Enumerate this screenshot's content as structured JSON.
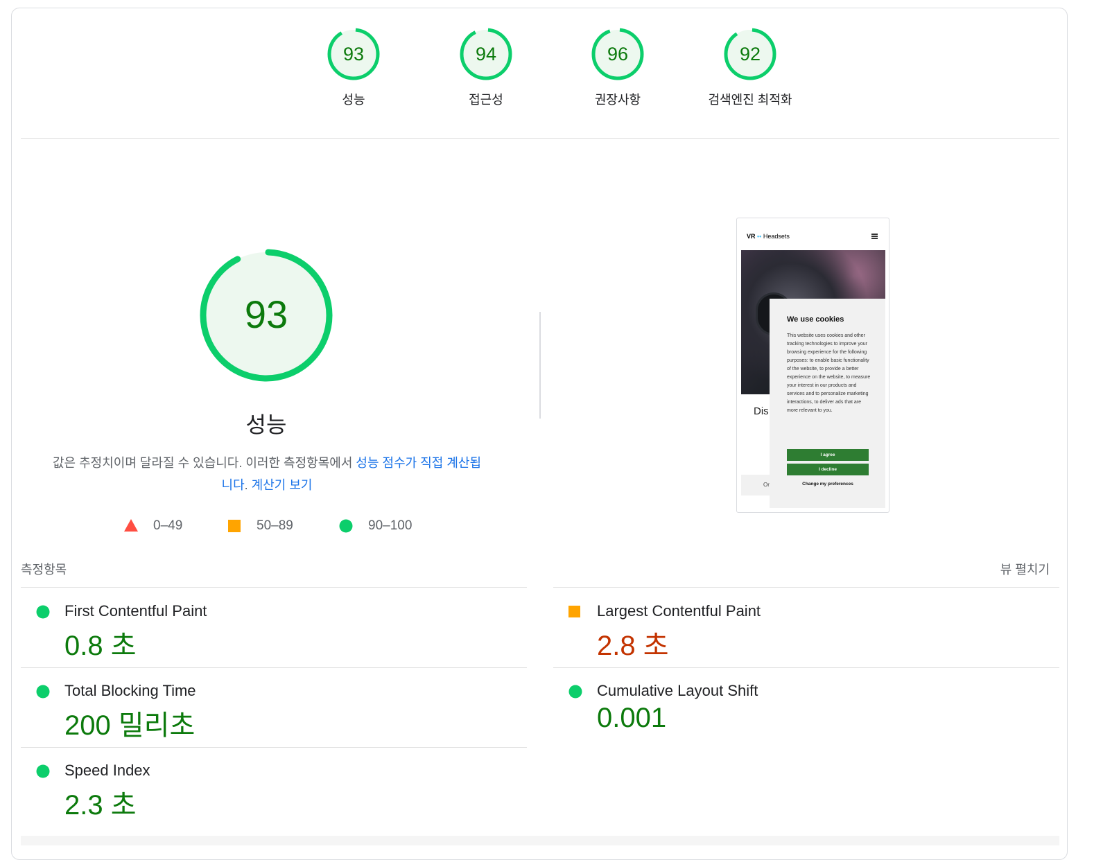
{
  "colors": {
    "pass": "#0cce6b",
    "pass_bg": "#edf8ef",
    "pass_text": "#0c7a0c",
    "average": "#ffa400",
    "average_text": "#c33300",
    "fail": "#ff4e42",
    "link": "#1a73e8"
  },
  "gauges": [
    {
      "score": "93",
      "label": "성능",
      "value": 93
    },
    {
      "score": "94",
      "label": "접근성",
      "value": 94
    },
    {
      "score": "96",
      "label": "권장사항",
      "value": 96
    },
    {
      "score": "92",
      "label": "검색엔진 최적화",
      "value": 92
    }
  ],
  "performance": {
    "score": "93",
    "value": 93,
    "title": "성능",
    "desc_text": "값은 추정치이며 달라질 수 있습니다. 이러한 측정항목에서 ",
    "desc_link1": "성능 점수가 직접 계산됩",
    "desc_link1b": "니다",
    "desc_mid": ". ",
    "desc_link2": "계산기 보기"
  },
  "legend": [
    {
      "shape": "triangle",
      "range": "0–49"
    },
    {
      "shape": "square",
      "range": "50–89"
    },
    {
      "shape": "circle",
      "range": "90–100"
    }
  ],
  "screenshot": {
    "brand_prefix": "VR",
    "brand_dots": "••",
    "brand_name": "Headsets",
    "partial_text": "Dis",
    "footer_text": "Or",
    "cookie_title": "We use cookies",
    "cookie_body": "This website uses cookies and other tracking technologies to improve your browsing experience for the following purposes: to enable basic functionality of the website, to provide a better experience on the website, to measure your interest in our products and services and to personalize marketing interactions, to deliver ads that are more relevant to you.",
    "agree_label": "I agree",
    "decline_label": "I decline",
    "prefs_label": "Change my preferences"
  },
  "metrics_header": {
    "title": "측정항목",
    "expand_label": "뷰 펼치기"
  },
  "metrics": [
    {
      "name": "First Contentful Paint",
      "value": "0.8 초",
      "status": "pass"
    },
    {
      "name": "Largest Contentful Paint",
      "value": "2.8 초",
      "status": "average"
    },
    {
      "name": "Total Blocking Time",
      "value": "200 밀리초",
      "status": "pass"
    },
    {
      "name": "Cumulative Layout Shift",
      "value": "0.001",
      "status": "pass"
    },
    {
      "name": "Speed Index",
      "value": "2.3 초",
      "status": "pass"
    }
  ]
}
